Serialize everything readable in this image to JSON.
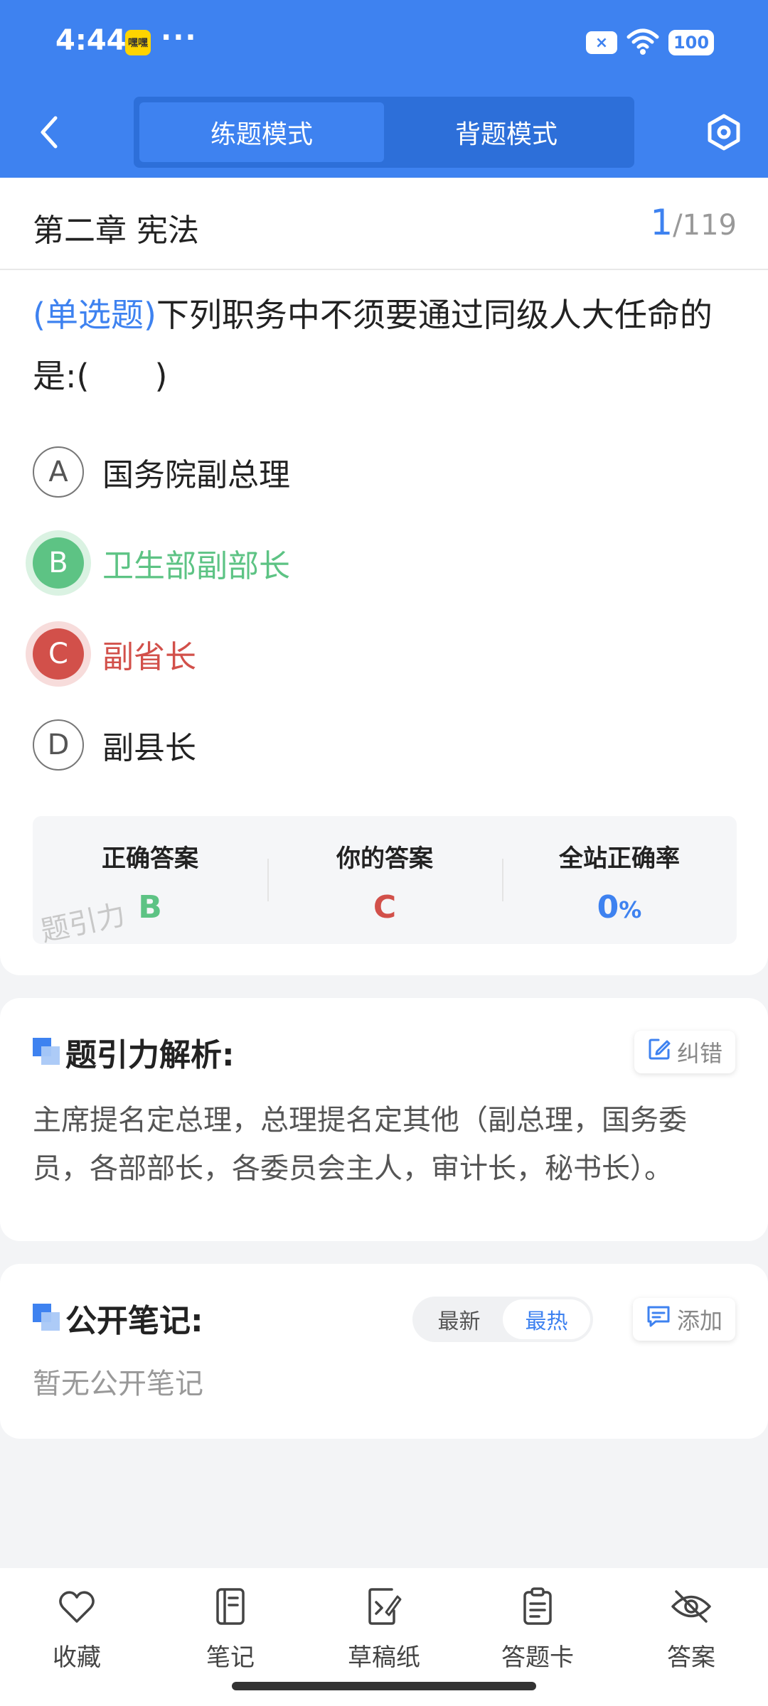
{
  "status": {
    "time": "4:44",
    "app_badge": "嘿嘿",
    "dots": "···",
    "sim_label": "×",
    "battery": "100"
  },
  "nav": {
    "tabs": [
      {
        "label": "练题模式",
        "active": true
      },
      {
        "label": "背题模式",
        "active": false
      }
    ],
    "back_icon": "chevron-left-icon",
    "settings_icon": "hexagon-settings-icon"
  },
  "question": {
    "chapter": "第二章 宪法",
    "current": "1",
    "separator": "/",
    "total": "119",
    "type": "(单选题)",
    "text": "下列职务中不须要通过同级人大任命的是:(　　)",
    "options": [
      {
        "letter": "A",
        "text": "国务院副总理",
        "state": "normal"
      },
      {
        "letter": "B",
        "text": "卫生部副部长",
        "state": "correct"
      },
      {
        "letter": "C",
        "text": "副省长",
        "state": "wrong"
      },
      {
        "letter": "D",
        "text": "副县长",
        "state": "normal"
      }
    ]
  },
  "answer": {
    "correct_label": "正确答案",
    "correct_value": "B",
    "yours_label": "你的答案",
    "yours_value": "C",
    "rate_label": "全站正确率",
    "rate_value": "0",
    "rate_unit": "%",
    "watermark": "题引力"
  },
  "analysis": {
    "title": "题引力解析:",
    "report_label": "纠错",
    "text": "主席提名定总理，总理提名定其他（副总理，国务委员，各部部长，各委员会主人，审计长，秘书长）。"
  },
  "notes": {
    "title": "公开笔记:",
    "sort_latest": "最新",
    "sort_hot": "最热",
    "add_label": "添加",
    "empty": "暂无公开笔记"
  },
  "bottom_tabs": [
    {
      "label": "收藏",
      "icon": "heart-icon"
    },
    {
      "label": "笔记",
      "icon": "notebook-icon"
    },
    {
      "label": "草稿纸",
      "icon": "draft-icon"
    },
    {
      "label": "答题卡",
      "icon": "clipboard-icon"
    },
    {
      "label": "答案",
      "icon": "eye-off-icon"
    }
  ],
  "colors": {
    "primary": "#3e82f0",
    "correct": "#5dc384",
    "wrong": "#d2504a"
  }
}
